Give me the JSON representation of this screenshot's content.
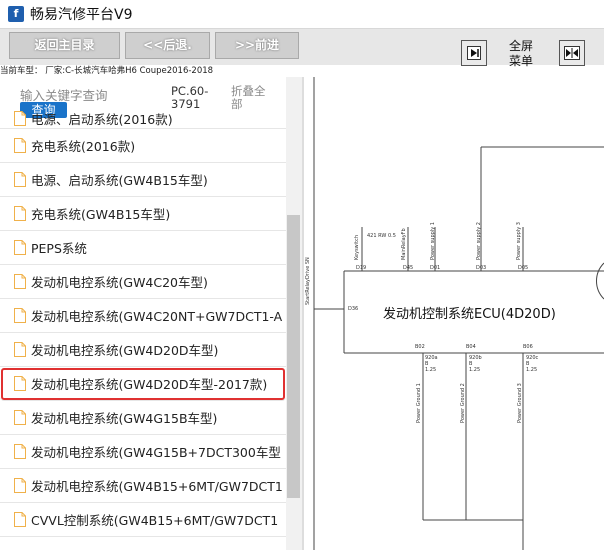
{
  "app": {
    "icon_glyph": "f",
    "title": "畅易汽修平台V9"
  },
  "toolbar": {
    "home_label": "返回主目录",
    "back_label": "<<后退.",
    "forward_label": ">>前进",
    "fullscreen_label_line1": "全屏",
    "fullscreen_label_line2": "菜单",
    "left_icon": "collapse-panel-icon",
    "right_icon": "expand-panel-icon"
  },
  "subtitle": "当前车型： 厂家:C-长城汽车哈弗H6 Coupe2016-2018",
  "search": {
    "placeholder": "输入关键字查询",
    "button_label": "查询"
  },
  "pc_code": {
    "line1": "PC.60-",
    "line2": "3791"
  },
  "collapse_all": {
    "line1": "折叠全",
    "line2": "部"
  },
  "list": {
    "items": [
      {
        "label": "电源、启动系统(2016款)"
      },
      {
        "label": "充电系统(2016款)"
      },
      {
        "label": "电源、启动系统(GW4B15车型)"
      },
      {
        "label": "充电系统(GW4B15车型)"
      },
      {
        "label": "PEPS系统"
      },
      {
        "label": "发动机电控系统(GW4C20车型)"
      },
      {
        "label": "发动机电控系统(GW4C20NT+GW7DCT1-A"
      },
      {
        "label": "发动机电控系统(GW4D20D车型)"
      },
      {
        "label": "发动机电控系统(GW4D20D车型-2017款)"
      },
      {
        "label": "发动机电控系统(GW4G15B车型)"
      },
      {
        "label": "发动机电控系统(GW4G15B+7DCT300车型"
      },
      {
        "label": "发动机电控系统(GW4B15+6MT/GW7DCT1"
      },
      {
        "label": "CVVL控制系统(GW4B15+6MT/GW7DCT1"
      }
    ]
  },
  "diagram": {
    "ecu_title": "发动机控制系统ECU(4D20D)",
    "top_pins": [
      "D19",
      "D45",
      "D01",
      "D03",
      "D05"
    ],
    "top_wire_labels": [
      "Keyswitch",
      "421 RW 0.5",
      "MainRelayFb",
      "Power supply 1",
      "Power supply 2",
      "Power supply 3"
    ],
    "left_pin": "D36",
    "left_wire_label": "StartRelayDrive SN",
    "bottom_pins": [
      "B02",
      "B04",
      "B06"
    ],
    "bottom_wires": [
      {
        "code": "920a",
        "color": "B",
        "size": "1.25"
      },
      {
        "code": "920b",
        "color": "B",
        "size": "1.25"
      },
      {
        "code": "920c",
        "color": "B",
        "size": "1.25"
      }
    ],
    "bottom_wire_labels": [
      "Power Ground 1",
      "Power Ground 2",
      "Power Ground 3"
    ]
  }
}
